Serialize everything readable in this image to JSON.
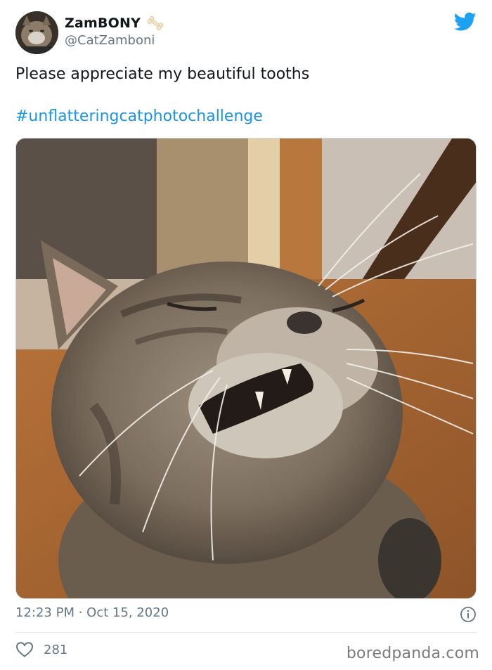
{
  "author": {
    "display_name": "ZamBONY",
    "handle": "@CatZamboni",
    "emoji_icon": "bone-icon"
  },
  "tweet": {
    "text": "Please appreciate my beautiful tooths",
    "hashtag": "#unflatteringcatphotochallenge",
    "timestamp": "12:23 PM · Oct 15, 2020",
    "like_count": "281"
  },
  "watermark": "boredpanda.com",
  "colors": {
    "twitter_blue": "#1da1f2",
    "hashtag_blue": "#1b95e0",
    "muted_text": "#657786"
  },
  "icons": [
    "twitter-bird-icon",
    "bone-icon",
    "info-icon",
    "heart-icon"
  ]
}
